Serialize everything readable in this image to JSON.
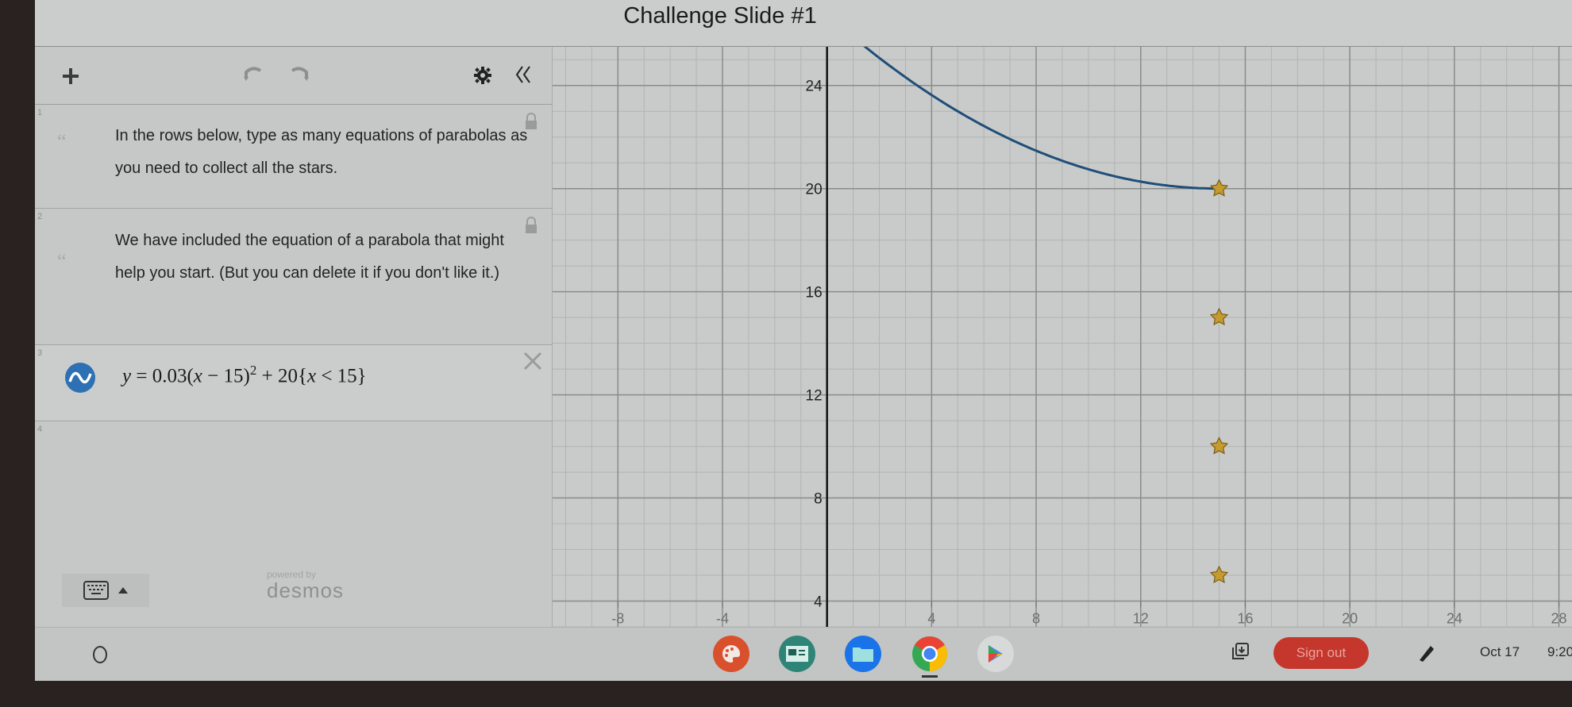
{
  "window": {
    "title": "Challenge Slide #1"
  },
  "toolbar": {
    "add_icon": "plus-icon",
    "undo_icon": "undo-icon",
    "redo_icon": "redo-icon",
    "settings_icon": "gear-icon",
    "collapse_icon": "double-chevron-left-icon"
  },
  "expressions": [
    {
      "index": "1",
      "type": "note",
      "locked": true,
      "text": "In the rows below, type as many equations of parabolas as you need to collect all the stars."
    },
    {
      "index": "2",
      "type": "note",
      "locked": true,
      "text": "We have included the equation of a parabola that might help you start. (But you can delete it if you don't like it.)"
    },
    {
      "index": "3",
      "type": "expression",
      "latex_text": "y=0.03(x−15)^2+20{x<15}",
      "parts": {
        "lhs": "y",
        "coef": "0.03",
        "var": "x",
        "h": "15",
        "exp": "2",
        "k": "20",
        "cond_var": "x",
        "cond_op": "<",
        "cond_val": "15"
      },
      "color": "#2d70b3"
    },
    {
      "index": "4",
      "type": "empty"
    }
  ],
  "footer": {
    "powered_by": "powered by",
    "brand": "desmos",
    "keypad_icon": "keyboard-icon"
  },
  "chart_data": {
    "type": "line",
    "title": "",
    "xlabel": "",
    "ylabel": "",
    "xlim": [
      -10.5,
      28.5
    ],
    "ylim": [
      3,
      25.5
    ],
    "x_ticks": [
      -8,
      -4,
      4,
      8,
      12,
      16,
      20,
      24,
      28
    ],
    "y_ticks": [
      4,
      8,
      12,
      16,
      20,
      24
    ],
    "grid": true,
    "series": [
      {
        "name": "y=0.03(x-15)^2+20 {x<15}",
        "color": "#1f4e79",
        "function": {
          "a": 0.03,
          "h": 15,
          "k": 20,
          "x_max": 15
        }
      }
    ],
    "stars": [
      {
        "x": 15,
        "y": 20
      },
      {
        "x": 15,
        "y": 15
      },
      {
        "x": 15,
        "y": 10
      },
      {
        "x": 15,
        "y": 5
      }
    ],
    "star_color": "#c59a2e"
  },
  "taskbar": {
    "launcher_icon": "launcher-circle-icon",
    "apps": [
      {
        "name": "canvas-app-icon",
        "color": "#d9512c"
      },
      {
        "name": "classroom-app-icon",
        "color": "#2e8577"
      },
      {
        "name": "files-app-icon",
        "color": "#1a73e8"
      },
      {
        "name": "chrome-app-icon",
        "color": "#ffffff"
      },
      {
        "name": "play-store-app-icon",
        "color": "#d8dad9"
      }
    ],
    "sign_out_label": "Sign out",
    "date": "Oct 17",
    "time": "9:20"
  }
}
